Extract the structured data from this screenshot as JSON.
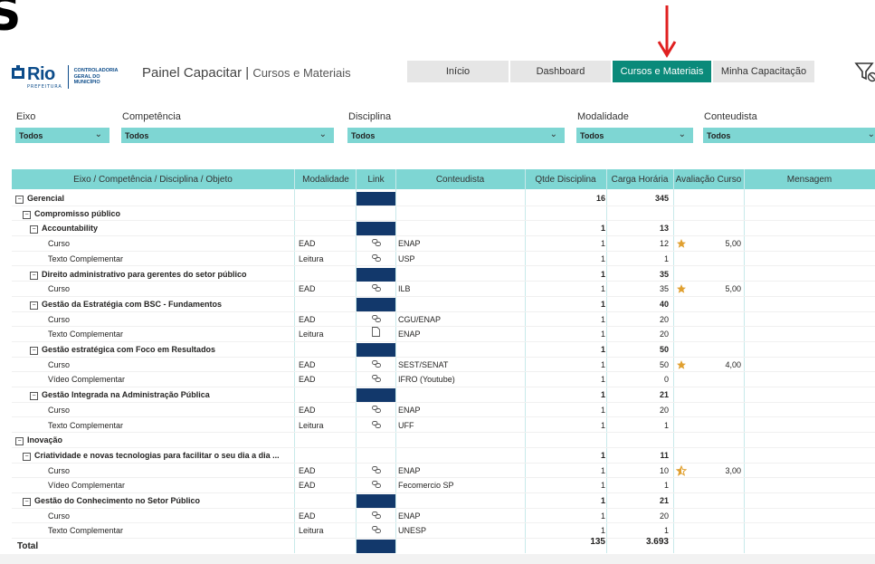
{
  "corner_glyph": "S",
  "header": {
    "logo_word": "Rio",
    "logo_sub": "PREFEITURA",
    "logo_org": [
      "CONTROLADORIA",
      "GERAL DO",
      "MUNICÍPIO"
    ],
    "title": "Painel Capacitar",
    "title_sep": "|",
    "subtitle": "Cursos e Materiais"
  },
  "nav": [
    {
      "label": "Início",
      "active": false
    },
    {
      "label": "Dashboard",
      "active": false
    },
    {
      "label": "Cursos e Materiais",
      "active": true
    },
    {
      "label": "Minha Capacitação",
      "active": false
    }
  ],
  "slicers": [
    {
      "label": "Eixo",
      "value": "Todos"
    },
    {
      "label": "Competência",
      "value": "Todos"
    },
    {
      "label": "Disciplina",
      "value": "Todos"
    },
    {
      "label": "Modalidade",
      "value": "Todos"
    },
    {
      "label": "Conteudista",
      "value": "Todos"
    }
  ],
  "table": {
    "headers": [
      "Eixo / Competência / Disciplina / Objeto",
      "Modalidade",
      "Link",
      "Conteudista",
      "Qtde Disciplina",
      "Carga Horária",
      "Avaliação Curso",
      "Mensagem"
    ],
    "rows": [
      {
        "level": 0,
        "name": "Gerencial",
        "toggle": true,
        "linkbox": true,
        "qtde": "16",
        "carga": "345"
      },
      {
        "level": 1,
        "name": "Compromisso público",
        "toggle": true
      },
      {
        "level": 2,
        "name": "Accountability",
        "toggle": true,
        "linkbox": true,
        "qtde": "1",
        "carga": "13"
      },
      {
        "level": 3,
        "name": "Curso",
        "mod": "EAD",
        "link": "link",
        "cont": "ENAP",
        "qtde": "1",
        "carga": "12",
        "star": "full",
        "aval": "5,00"
      },
      {
        "level": 3,
        "name": "Texto Complementar",
        "mod": "Leitura",
        "link": "link",
        "cont": "USP",
        "qtde": "1",
        "carga": "1"
      },
      {
        "level": 2,
        "name": "Direito administrativo para gerentes do setor público",
        "toggle": true,
        "linkbox": true,
        "qtde": "1",
        "carga": "35"
      },
      {
        "level": 3,
        "name": "Curso",
        "mod": "EAD",
        "link": "link",
        "cont": "ILB",
        "qtde": "1",
        "carga": "35",
        "star": "full",
        "aval": "5,00"
      },
      {
        "level": 2,
        "name": "Gestão da Estratégia com BSC - Fundamentos",
        "toggle": true,
        "linkbox": true,
        "qtde": "1",
        "carga": "40"
      },
      {
        "level": 3,
        "name": "Curso",
        "mod": "EAD",
        "link": "link",
        "cont": "CGU/ENAP",
        "qtde": "1",
        "carga": "20"
      },
      {
        "level": 3,
        "name": "Texto Complementar",
        "mod": "Leitura",
        "link": "doc",
        "cont": "ENAP",
        "qtde": "1",
        "carga": "20"
      },
      {
        "level": 2,
        "name": "Gestão estratégica com Foco em Resultados",
        "toggle": true,
        "linkbox": true,
        "qtde": "1",
        "carga": "50"
      },
      {
        "level": 3,
        "name": "Curso",
        "mod": "EAD",
        "link": "link",
        "cont": "SEST/SENAT",
        "qtde": "1",
        "carga": "50",
        "star": "full",
        "aval": "4,00"
      },
      {
        "level": 3,
        "name": "Vídeo Complementar",
        "mod": "EAD",
        "link": "link",
        "cont": "IFRO (Youtube)",
        "qtde": "1",
        "carga": "0"
      },
      {
        "level": 2,
        "name": "Gestão Integrada na Administração Pública",
        "toggle": true,
        "linkbox": true,
        "qtde": "1",
        "carga": "21"
      },
      {
        "level": 3,
        "name": "Curso",
        "mod": "EAD",
        "link": "link",
        "cont": "ENAP",
        "qtde": "1",
        "carga": "20"
      },
      {
        "level": 3,
        "name": "Texto Complementar",
        "mod": "Leitura",
        "link": "link",
        "cont": "UFF",
        "qtde": "1",
        "carga": "1"
      },
      {
        "level": 0,
        "name": "Inovação",
        "toggle": true
      },
      {
        "level": 1,
        "name": "Criatividade e novas tecnologias para facilitar o seu dia a dia ...",
        "toggle": true,
        "qtde": "1",
        "carga": "11"
      },
      {
        "level": 3,
        "name": "Curso",
        "mod": "EAD",
        "link": "link",
        "cont": "ENAP",
        "qtde": "1",
        "carga": "10",
        "star": "half",
        "aval": "3,00"
      },
      {
        "level": 3,
        "name": "Vídeo Complementar",
        "mod": "EAD",
        "link": "link",
        "cont": "Fecomercio SP",
        "qtde": "1",
        "carga": "1"
      },
      {
        "level": 1,
        "name": "Gestão do Conhecimento no Setor Público",
        "toggle": true,
        "linkbox": true,
        "qtde": "1",
        "carga": "21"
      },
      {
        "level": 3,
        "name": "Curso",
        "mod": "EAD",
        "link": "link",
        "cont": "ENAP",
        "qtde": "1",
        "carga": "20"
      },
      {
        "level": 3,
        "name": "Texto Complementar",
        "mod": "Leitura",
        "link": "link",
        "cont": "UNESP",
        "qtde": "1",
        "carga": "1"
      }
    ],
    "total": {
      "label": "Total",
      "qtde": "135",
      "carga": "3.693"
    }
  },
  "colors": {
    "accent": "#7ed6d3",
    "active_tab": "#0a8a7a",
    "link_box": "#12386b",
    "star": "#e0a030",
    "arrow": "#e02020"
  }
}
